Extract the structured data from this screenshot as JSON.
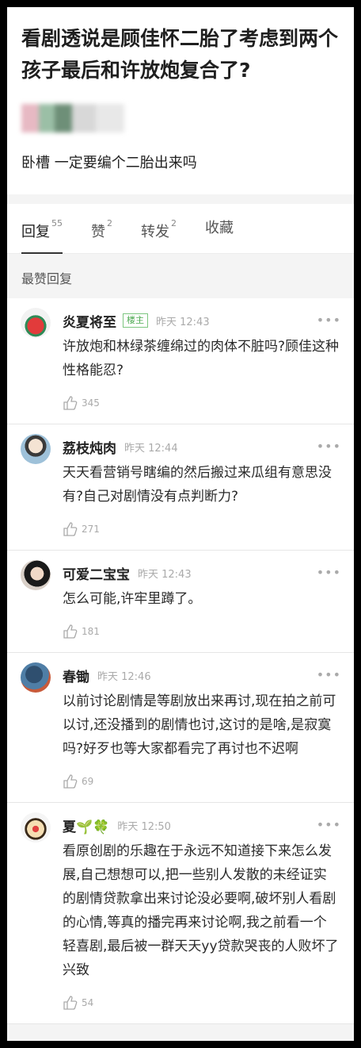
{
  "post": {
    "title": "看剧透说是顾佳怀二胎了考虑到两个孩子最后和许放炮复合了?",
    "body": "卧槽 一定要编个二胎出来吗"
  },
  "tabs": [
    {
      "label": "回复",
      "count": "55"
    },
    {
      "label": "赞",
      "count": "2"
    },
    {
      "label": "转发",
      "count": "2"
    },
    {
      "label": "收藏",
      "count": ""
    }
  ],
  "section_title": "最赞回复",
  "comments": [
    {
      "name": "炎夏将至",
      "badge": "楼主",
      "time": "昨天 12:43",
      "text": "许放炮和林绿茶缠绵过的肉体不脏吗?顾佳这种性格能忍?",
      "likes": "345"
    },
    {
      "name": "荔枝炖肉",
      "badge": "",
      "time": "昨天 12:44",
      "text": "天天看营销号瞎编的然后搬过来瓜组有意思没有?自己对剧情没有点判断力?",
      "likes": "271"
    },
    {
      "name": "可爱二宝宝",
      "badge": "",
      "time": "昨天 12:43",
      "text": "怎么可能,许牢里蹲了。",
      "likes": "181"
    },
    {
      "name": "春锄",
      "badge": "",
      "time": "昨天 12:46",
      "text": "以前讨论剧情是等剧放出来再讨,现在拍之前可以讨,还没播到的剧情也讨,这讨的是啥,是寂寞吗?好歹也等大家都看完了再讨也不迟啊",
      "likes": "69"
    },
    {
      "name": "夏🌱🍀",
      "badge": "",
      "time": "昨天 12:50",
      "text": "看原创剧的乐趣在于永远不知道接下来怎么发展,自己想想可以,把一些别人发散的未经证实的剧情贷款拿出来讨论没必要啊,破坏别人看剧的心情,等真的播完再来讨论啊,我之前看一个轻喜剧,最后被一群天天yy贷款哭丧的人败坏了兴致",
      "likes": "54"
    }
  ],
  "colors": {
    "badge": "#4aa84f",
    "muted": "#aaaaaa"
  }
}
